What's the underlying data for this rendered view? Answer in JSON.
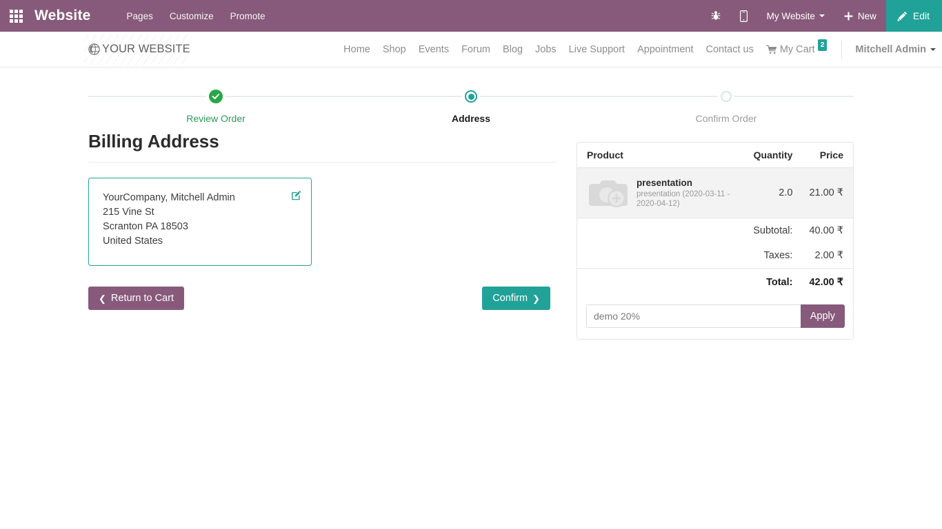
{
  "systembar": {
    "apps_icon": "apps-grid-icon",
    "title": "Website",
    "menu": [
      {
        "label": "Pages"
      },
      {
        "label": "Customize"
      },
      {
        "label": "Promote"
      }
    ],
    "bug_icon": "bug-icon",
    "mobile_icon": "mobile-preview-icon",
    "website_selector": "My Website",
    "new_label": "New",
    "new_icon": "plus-icon",
    "edit_label": "Edit",
    "edit_icon": "pencil-icon",
    "bg_color": "#875A7B",
    "edit_bg_color": "#21A299"
  },
  "sitenav": {
    "logo_icon": "globe-icon",
    "logo_text": "YOUR WEBSITE",
    "links": [
      {
        "label": "Home"
      },
      {
        "label": "Shop"
      },
      {
        "label": "Events"
      },
      {
        "label": "Forum"
      },
      {
        "label": "Blog"
      },
      {
        "label": "Jobs"
      },
      {
        "label": "Live Support"
      },
      {
        "label": "Appointment"
      },
      {
        "label": "Contact us"
      }
    ],
    "cart_label": "My Cart",
    "cart_icon": "shopping-cart-icon",
    "cart_count": "2",
    "cart_badge_color": "#21A299",
    "user_label": "Mitchell Admin"
  },
  "steps": [
    {
      "label": "Review Order",
      "state": "done",
      "marker": "check-circle-icon",
      "color": "#28a745"
    },
    {
      "label": "Address",
      "state": "current",
      "marker": "filled-circle-icon",
      "color": "#21A299"
    },
    {
      "label": "Confirm Order",
      "state": "todo",
      "marker": "empty-circle-icon",
      "color": "#dee2e6"
    }
  ],
  "billing": {
    "title": "Billing Address",
    "edit_icon": "edit-address-icon",
    "address_lines": [
      "YourCompany, Mitchell Admin",
      "215 Vine St",
      "Scranton PA 18503",
      "United States"
    ]
  },
  "actions": {
    "return_label": "Return to Cart",
    "return_icon": "chevron-left-icon",
    "return_color": "#875A7B",
    "confirm_label": "Confirm",
    "confirm_icon": "chevron-right-icon",
    "confirm_color": "#21A299"
  },
  "order_summary": {
    "columns": {
      "product": "Product",
      "quantity": "Quantity",
      "price": "Price"
    },
    "items": [
      {
        "thumb_icon": "image-placeholder-icon",
        "name": "presentation",
        "description": "presentation (2020-03-11 - 2020-04-12)",
        "quantity": "2.0",
        "price": "21.00 ₹"
      }
    ],
    "totals": [
      {
        "label": "Subtotal:",
        "value": "40.00 ₹"
      },
      {
        "label": "Taxes:",
        "value": "2.00 ₹"
      }
    ],
    "grand_total": {
      "label": "Total:",
      "value": "42.00 ₹"
    },
    "promo": {
      "placeholder": "demo 20%",
      "value": "",
      "apply_label": "Apply"
    }
  }
}
